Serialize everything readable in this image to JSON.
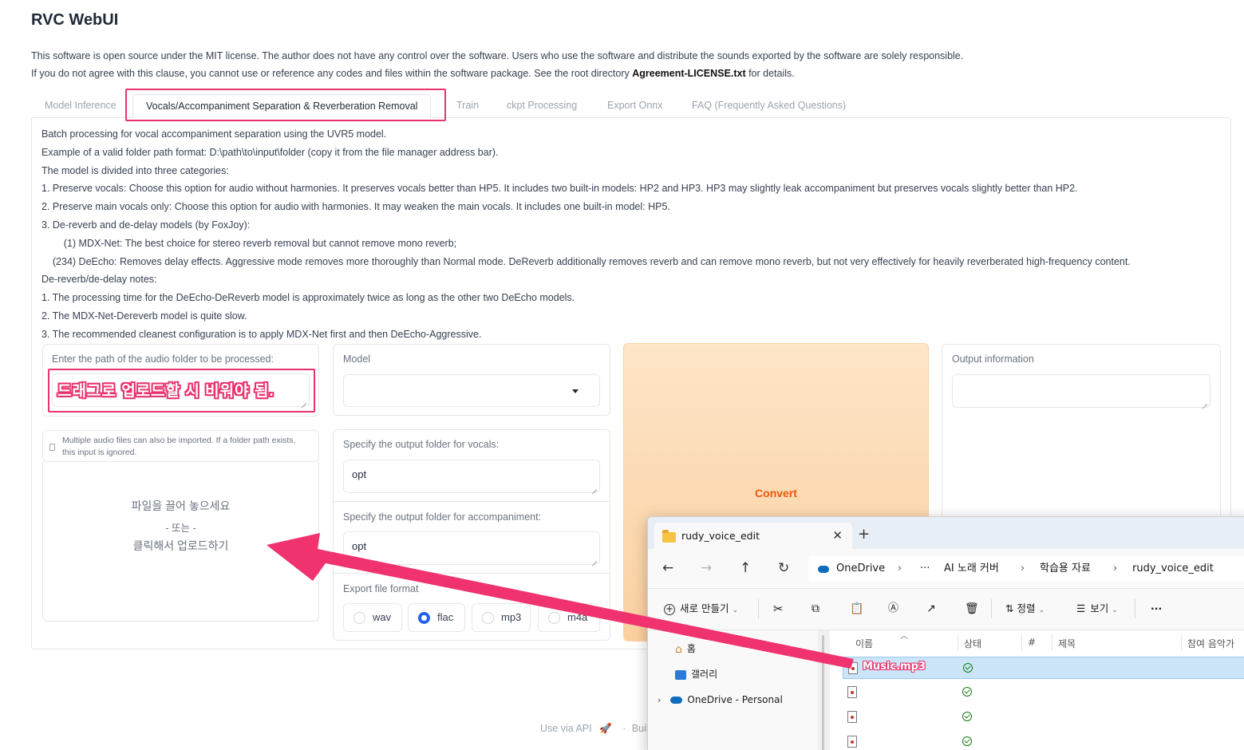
{
  "app": {
    "title": "RVC WebUI",
    "intro_line1": "This software is open source under the MIT license. The author does not have any control over the software. Users who use the software and distribute the sounds exported by the software are solely responsible.",
    "intro_line2_pre": "If you do not agree with this clause, you cannot use or reference any codes and files within the software package. See the root directory ",
    "intro_line2_bold": "Agreement-LICENSE.txt",
    "intro_line2_post": " for details."
  },
  "tabs": [
    {
      "label": "Model Inference",
      "active": false
    },
    {
      "label": "Vocals/Accompaniment Separation & Reverberation Removal",
      "active": true
    },
    {
      "label": "Train",
      "active": false
    },
    {
      "label": "ckpt Processing",
      "active": false
    },
    {
      "label": "Export Onnx",
      "active": false
    },
    {
      "label": "FAQ (Frequently Asked Questions)",
      "active": false
    }
  ],
  "description": [
    "Batch processing for vocal accompaniment separation using the UVR5 model.",
    "Example of a valid folder path format: D:\\path\\to\\input\\folder (copy it from the file manager address bar).",
    "The model is divided into three categories:",
    "1. Preserve vocals: Choose this option for audio without harmonies. It preserves vocals better than HP5. It includes two built-in models: HP2 and HP3. HP3 may slightly leak accompaniment but preserves vocals slightly better than HP2.",
    "2. Preserve main vocals only: Choose this option for audio with harmonies. It may weaken the main vocals. It includes one built-in model: HP5.",
    "3. De-reverb and de-delay models (by FoxJoy):",
    "        (1) MDX-Net: The best choice for stereo reverb removal but cannot remove mono reverb;",
    "    (234) DeEcho: Removes delay effects. Aggressive mode removes more thoroughly than Normal mode. DeReverb additionally removes reverb and can remove mono reverb, but not very effectively for heavily reverberated high-frequency content.",
    "De-reverb/de-delay notes:",
    "1. The processing time for the DeEcho-DeReverb model is approximately twice as long as the other two DeEcho models.",
    "2. The MDX-Net-Dereverb model is quite slow.",
    "3. The recommended cleanest configuration is to apply MDX-Net first and then DeEcho-Aggressive."
  ],
  "form": {
    "path_label": "Enter the path of the audio folder to be processed:",
    "path_value": "",
    "path_annotation": "드래그로 업로드할 시 비워야 됨.",
    "file_hint": "Multiple audio files can also be imported. If a folder path exists, this input is ignored.",
    "drop_line1": "파일을 끌어 놓으세요",
    "drop_line2": "- 또는 -",
    "drop_line3": "클릭해서 업로드하기",
    "model_label": "Model",
    "model_value": "",
    "vocals_label": "Specify the output folder for vocals:",
    "vocals_value": "opt",
    "accomp_label": "Specify the output folder for accompaniment:",
    "accomp_value": "opt",
    "format_label": "Export file format",
    "formats": [
      "wav",
      "flac",
      "mp3",
      "m4a"
    ],
    "format_selected": "flac",
    "convert_label": "Convert",
    "output_label": "Output information",
    "output_value": ""
  },
  "footer": {
    "api": "Use via API",
    "built": "Built"
  },
  "explorer": {
    "tab_title": "rudy_voice_edit",
    "close": "✕",
    "new_tab": "+",
    "path": [
      "OneDrive",
      "···",
      "AI 노래 커버",
      "학습용 자료",
      "rudy_voice_edit"
    ],
    "toolbar": {
      "new_label": "새로 만들기",
      "sort_label": "정렬",
      "view_label": "보기",
      "more_label": "···"
    },
    "sidebar": [
      "홈",
      "갤러리",
      "OneDrive - Personal"
    ],
    "columns": [
      "이름",
      "상태",
      "#",
      "제목",
      "참여 음악가"
    ],
    "files": [
      {
        "name": "Music.mp3",
        "selected": true
      },
      {
        "name": "",
        "selected": false
      },
      {
        "name": "",
        "selected": false
      },
      {
        "name": "",
        "selected": false
      }
    ]
  },
  "colors": {
    "highlight": "#e8336e",
    "accent": "#2563eb",
    "convert_text": "#ea580c"
  }
}
